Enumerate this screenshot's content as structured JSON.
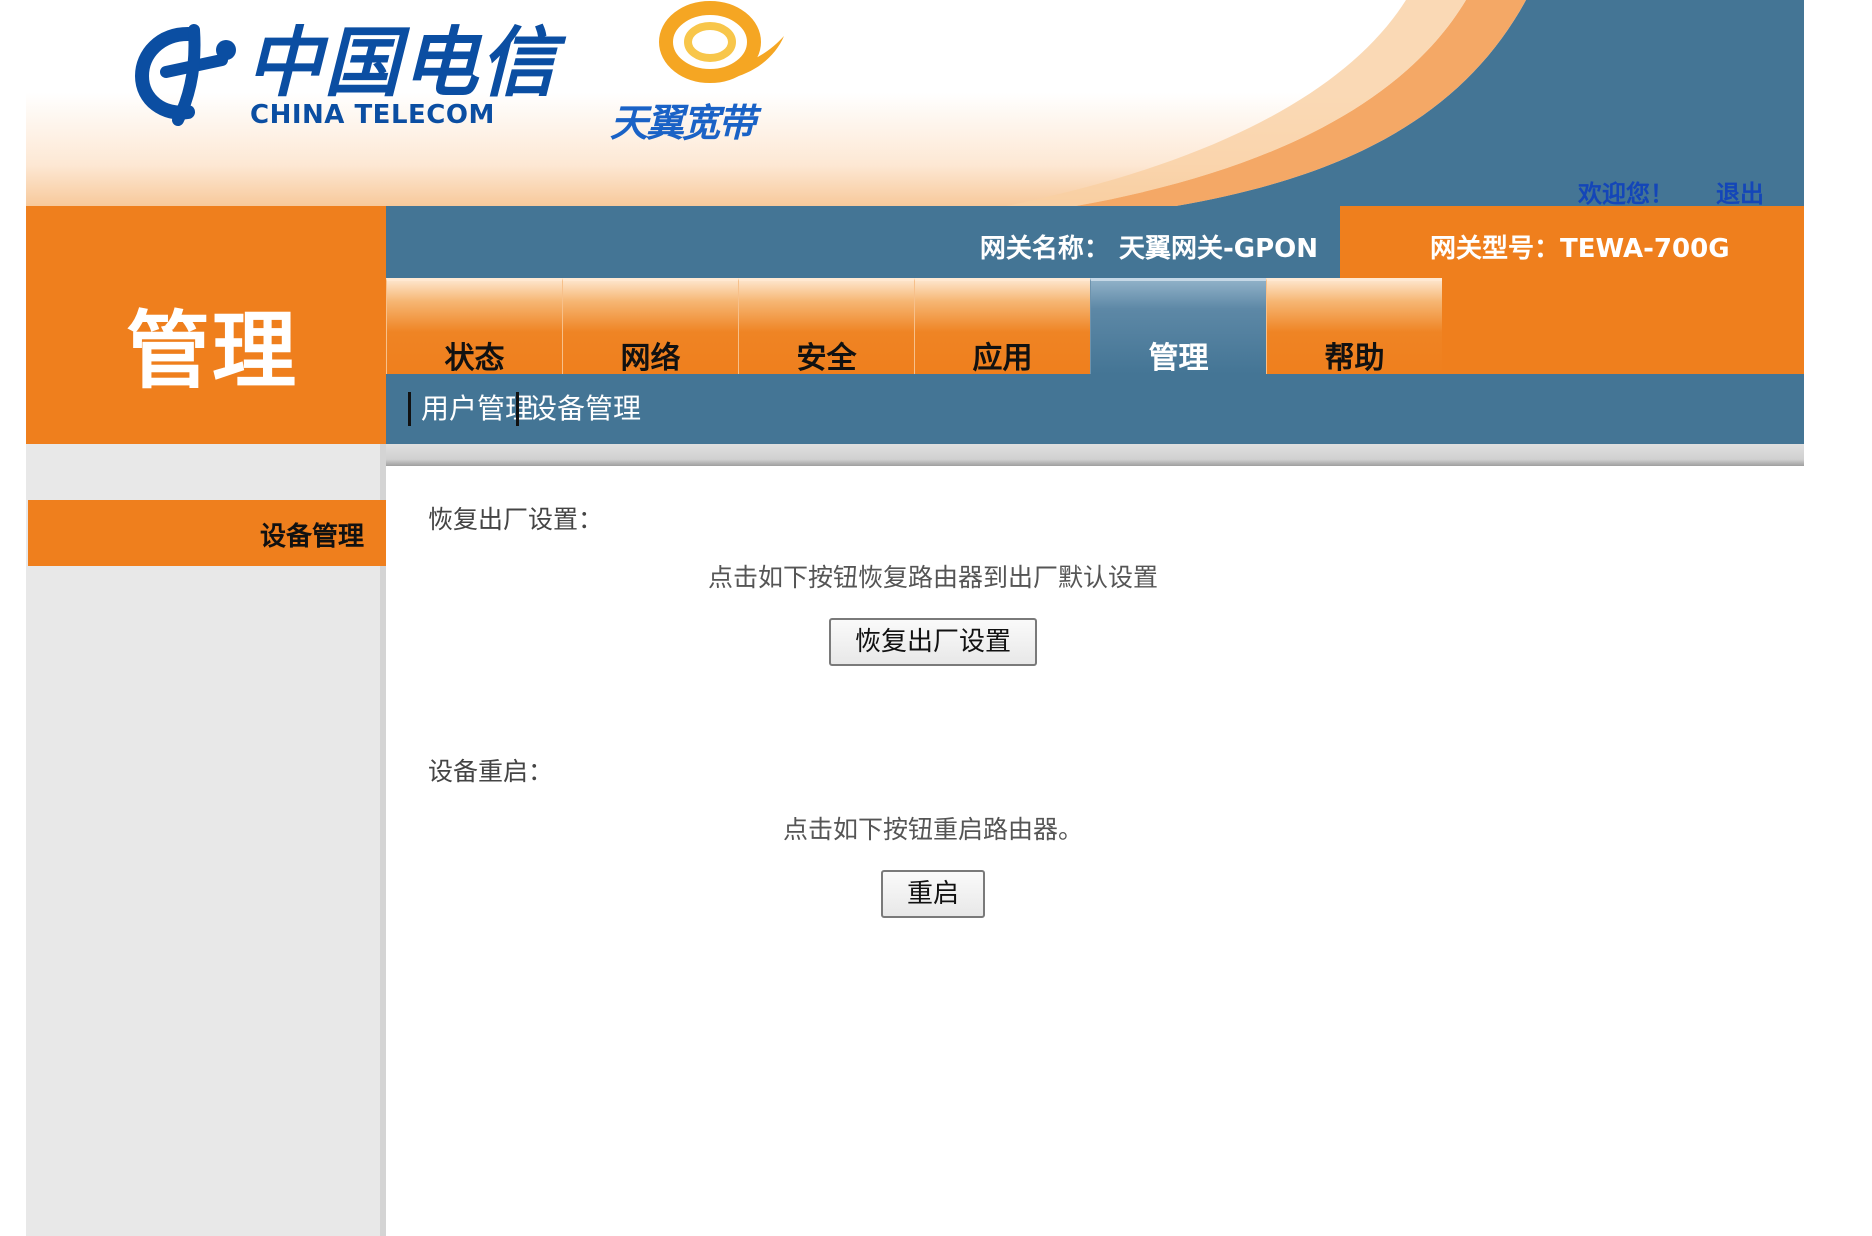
{
  "header": {
    "logo_cn": "中国电信",
    "logo_en": "CHINA TELECOM",
    "brand": "天翼宽带",
    "welcome": "欢迎您！",
    "logout": "退出"
  },
  "info": {
    "gateway_name": "网关名称：  天翼网关-GPON",
    "gateway_model": "网关型号：TEWA-700G"
  },
  "side_title": "管理",
  "tabs": [
    {
      "label": "状态",
      "active": false
    },
    {
      "label": "网络",
      "active": false
    },
    {
      "label": "安全",
      "active": false
    },
    {
      "label": "应用",
      "active": false
    },
    {
      "label": "管理",
      "active": true
    },
    {
      "label": "帮助",
      "active": false
    }
  ],
  "subnav": [
    {
      "label": "用户管理"
    },
    {
      "label": "设备管理"
    }
  ],
  "left_nav": [
    {
      "label": "设备管理",
      "active": true
    }
  ],
  "content": {
    "restore": {
      "title": "恢复出厂设置：",
      "desc": "点击如下按钮恢复路由器到出厂默认设置",
      "button": "恢复出厂设置"
    },
    "reboot": {
      "title": "设备重启：",
      "desc": "点击如下按钮重启路由器。",
      "button": "重启"
    }
  },
  "colors": {
    "orange": "#ef7f1d",
    "steel_blue": "#447595",
    "link_blue": "#1446b8",
    "panel_gray": "#e8e8e8"
  }
}
